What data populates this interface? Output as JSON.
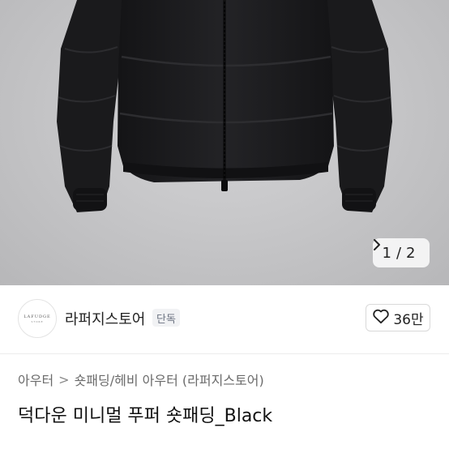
{
  "gallery": {
    "current_page": "1",
    "total_pages": "2",
    "separator": "/",
    "next_icon": "chevron-right-icon"
  },
  "store": {
    "logo_text": "LAFUDGE",
    "logo_subtext": "STORE",
    "name": "라퍼지스토어",
    "badge": "단독",
    "like_count": "36만",
    "like_icon": "heart-outline-icon"
  },
  "breadcrumb": {
    "category": "아우터",
    "separator": ">",
    "subcategory": "숏패딩/헤비 아우터 (라퍼지스토어)"
  },
  "product": {
    "title": "덕다운 미니멀 푸퍼 숏패딩_Black"
  },
  "colors": {
    "background_hero": "#c4c4c6",
    "jacket": "#1b1b1d",
    "badge_bg": "#f1f2f4",
    "rating_star": "#f5b301"
  }
}
